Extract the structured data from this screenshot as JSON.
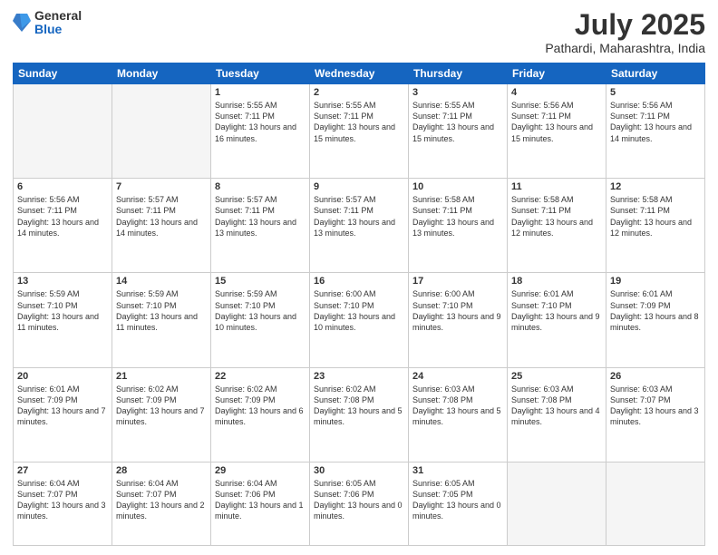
{
  "header": {
    "logo_general": "General",
    "logo_blue": "Blue",
    "title": "July 2025",
    "location": "Pathardi, Maharashtra, India"
  },
  "days_of_week": [
    "Sunday",
    "Monday",
    "Tuesday",
    "Wednesday",
    "Thursday",
    "Friday",
    "Saturday"
  ],
  "weeks": [
    [
      {
        "day": "",
        "info": ""
      },
      {
        "day": "",
        "info": ""
      },
      {
        "day": "1",
        "info": "Sunrise: 5:55 AM\nSunset: 7:11 PM\nDaylight: 13 hours\nand 16 minutes."
      },
      {
        "day": "2",
        "info": "Sunrise: 5:55 AM\nSunset: 7:11 PM\nDaylight: 13 hours\nand 15 minutes."
      },
      {
        "day": "3",
        "info": "Sunrise: 5:55 AM\nSunset: 7:11 PM\nDaylight: 13 hours\nand 15 minutes."
      },
      {
        "day": "4",
        "info": "Sunrise: 5:56 AM\nSunset: 7:11 PM\nDaylight: 13 hours\nand 15 minutes."
      },
      {
        "day": "5",
        "info": "Sunrise: 5:56 AM\nSunset: 7:11 PM\nDaylight: 13 hours\nand 14 minutes."
      }
    ],
    [
      {
        "day": "6",
        "info": "Sunrise: 5:56 AM\nSunset: 7:11 PM\nDaylight: 13 hours\nand 14 minutes."
      },
      {
        "day": "7",
        "info": "Sunrise: 5:57 AM\nSunset: 7:11 PM\nDaylight: 13 hours\nand 14 minutes."
      },
      {
        "day": "8",
        "info": "Sunrise: 5:57 AM\nSunset: 7:11 PM\nDaylight: 13 hours\nand 13 minutes."
      },
      {
        "day": "9",
        "info": "Sunrise: 5:57 AM\nSunset: 7:11 PM\nDaylight: 13 hours\nand 13 minutes."
      },
      {
        "day": "10",
        "info": "Sunrise: 5:58 AM\nSunset: 7:11 PM\nDaylight: 13 hours\nand 13 minutes."
      },
      {
        "day": "11",
        "info": "Sunrise: 5:58 AM\nSunset: 7:11 PM\nDaylight: 13 hours\nand 12 minutes."
      },
      {
        "day": "12",
        "info": "Sunrise: 5:58 AM\nSunset: 7:11 PM\nDaylight: 13 hours\nand 12 minutes."
      }
    ],
    [
      {
        "day": "13",
        "info": "Sunrise: 5:59 AM\nSunset: 7:10 PM\nDaylight: 13 hours\nand 11 minutes."
      },
      {
        "day": "14",
        "info": "Sunrise: 5:59 AM\nSunset: 7:10 PM\nDaylight: 13 hours\nand 11 minutes."
      },
      {
        "day": "15",
        "info": "Sunrise: 5:59 AM\nSunset: 7:10 PM\nDaylight: 13 hours\nand 10 minutes."
      },
      {
        "day": "16",
        "info": "Sunrise: 6:00 AM\nSunset: 7:10 PM\nDaylight: 13 hours\nand 10 minutes."
      },
      {
        "day": "17",
        "info": "Sunrise: 6:00 AM\nSunset: 7:10 PM\nDaylight: 13 hours\nand 9 minutes."
      },
      {
        "day": "18",
        "info": "Sunrise: 6:01 AM\nSunset: 7:10 PM\nDaylight: 13 hours\nand 9 minutes."
      },
      {
        "day": "19",
        "info": "Sunrise: 6:01 AM\nSunset: 7:09 PM\nDaylight: 13 hours\nand 8 minutes."
      }
    ],
    [
      {
        "day": "20",
        "info": "Sunrise: 6:01 AM\nSunset: 7:09 PM\nDaylight: 13 hours\nand 7 minutes."
      },
      {
        "day": "21",
        "info": "Sunrise: 6:02 AM\nSunset: 7:09 PM\nDaylight: 13 hours\nand 7 minutes."
      },
      {
        "day": "22",
        "info": "Sunrise: 6:02 AM\nSunset: 7:09 PM\nDaylight: 13 hours\nand 6 minutes."
      },
      {
        "day": "23",
        "info": "Sunrise: 6:02 AM\nSunset: 7:08 PM\nDaylight: 13 hours\nand 5 minutes."
      },
      {
        "day": "24",
        "info": "Sunrise: 6:03 AM\nSunset: 7:08 PM\nDaylight: 13 hours\nand 5 minutes."
      },
      {
        "day": "25",
        "info": "Sunrise: 6:03 AM\nSunset: 7:08 PM\nDaylight: 13 hours\nand 4 minutes."
      },
      {
        "day": "26",
        "info": "Sunrise: 6:03 AM\nSunset: 7:07 PM\nDaylight: 13 hours\nand 3 minutes."
      }
    ],
    [
      {
        "day": "27",
        "info": "Sunrise: 6:04 AM\nSunset: 7:07 PM\nDaylight: 13 hours\nand 3 minutes."
      },
      {
        "day": "28",
        "info": "Sunrise: 6:04 AM\nSunset: 7:07 PM\nDaylight: 13 hours\nand 2 minutes."
      },
      {
        "day": "29",
        "info": "Sunrise: 6:04 AM\nSunset: 7:06 PM\nDaylight: 13 hours\nand 1 minute."
      },
      {
        "day": "30",
        "info": "Sunrise: 6:05 AM\nSunset: 7:06 PM\nDaylight: 13 hours\nand 0 minutes."
      },
      {
        "day": "31",
        "info": "Sunrise: 6:05 AM\nSunset: 7:05 PM\nDaylight: 13 hours\nand 0 minutes."
      },
      {
        "day": "",
        "info": ""
      },
      {
        "day": "",
        "info": ""
      }
    ]
  ]
}
